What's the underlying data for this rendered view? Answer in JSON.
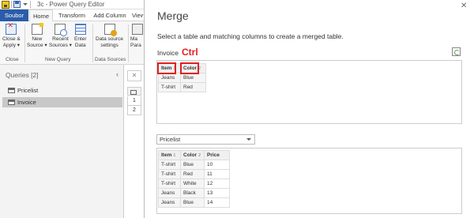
{
  "window": {
    "title": "3c - Power Query Editor"
  },
  "ribbon": {
    "tabs": [
      "Soubor",
      "Home",
      "Transform",
      "Add Column",
      "View"
    ],
    "buttons": {
      "close_apply": [
        "Close &",
        "Apply ▾"
      ],
      "new_source": [
        "New",
        "Source ▾"
      ],
      "recent_sources": [
        "Recent",
        "Sources ▾"
      ],
      "enter_data": [
        "Enter",
        "Data"
      ],
      "data_source_settings": [
        "Data source",
        "settings"
      ],
      "manage_parameters": [
        "Ma",
        "Para"
      ]
    },
    "groups": [
      "Close",
      "New Query",
      "Data Sources"
    ]
  },
  "queries": {
    "title": "Queries [2]",
    "collapse_icon": "chevron-left-icon",
    "items": [
      "Pricelist",
      "Invoice"
    ],
    "selected": "Invoice"
  },
  "editor": {
    "row_numbers": [
      "1",
      "2"
    ]
  },
  "dialog": {
    "title": "Merge",
    "description": "Select a table and matching columns to create a merged table.",
    "first_table_label": "Invoice",
    "annotation": "Ctrl",
    "first_preview": {
      "columns": [
        {
          "name": "Item",
          "index": "1"
        },
        {
          "name": "Color",
          "index": "2"
        }
      ],
      "rows": [
        [
          "Jeans",
          "Blue"
        ],
        [
          "T-shirt",
          "Red"
        ]
      ]
    },
    "second_table_select": "Pricelist",
    "second_preview": {
      "columns": [
        {
          "name": "Item",
          "index": "1"
        },
        {
          "name": "Color",
          "index": "2"
        },
        {
          "name": "Price",
          "index": ""
        }
      ],
      "rows": [
        [
          "T-shirt",
          "Blue",
          "10"
        ],
        [
          "T-shirt",
          "Red",
          "11"
        ],
        [
          "T-shirt",
          "White",
          "12"
        ],
        [
          "Jeans",
          "Black",
          "13"
        ],
        [
          "Jeans",
          "Blue",
          "14"
        ]
      ]
    }
  },
  "colors": {
    "file_tab": "#2a5caa",
    "highlight": "#e02020",
    "selected_query": "#c8c8c8"
  }
}
